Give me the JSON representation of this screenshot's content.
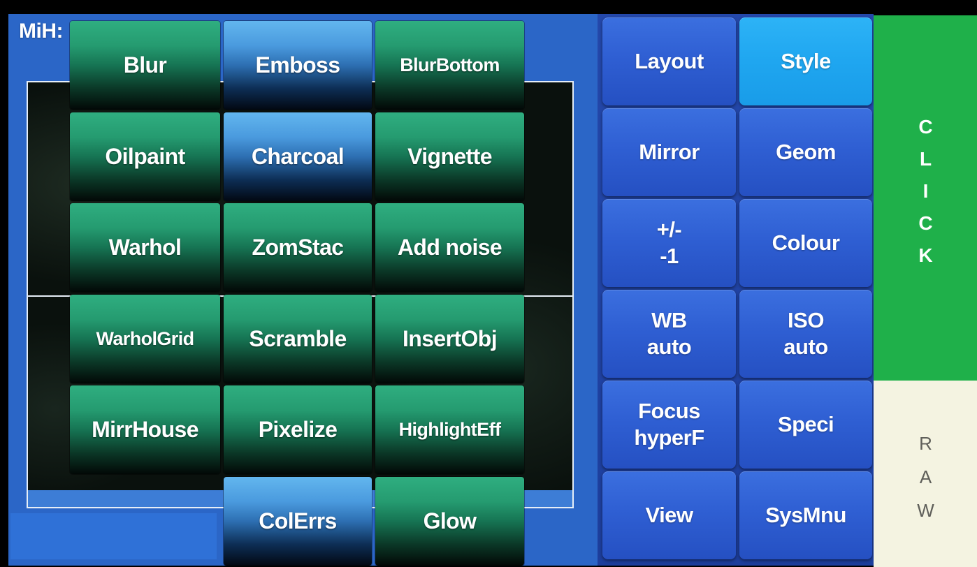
{
  "app": {
    "title": "MiH:"
  },
  "effects": [
    {
      "label": "Blur",
      "tint": "green"
    },
    {
      "label": "Emboss",
      "tint": "blue"
    },
    {
      "label": "BlurBottom",
      "tint": "green"
    },
    {
      "label": "Oilpaint",
      "tint": "green"
    },
    {
      "label": "Charcoal",
      "tint": "blue"
    },
    {
      "label": "Vignette",
      "tint": "green"
    },
    {
      "label": "Warhol",
      "tint": "green"
    },
    {
      "label": "ZomStac",
      "tint": "green"
    },
    {
      "label": "Add noise",
      "tint": "green"
    },
    {
      "label": "WarholGrid",
      "tint": "green"
    },
    {
      "label": "Scramble",
      "tint": "green"
    },
    {
      "label": "InsertObj",
      "tint": "green"
    },
    {
      "label": "MirrHouse",
      "tint": "green"
    },
    {
      "label": "Pixelize",
      "tint": "green"
    },
    {
      "label": "HighlightEff",
      "tint": "green"
    },
    {
      "label": "ColErrs",
      "tint": "blue"
    },
    {
      "label": "Glow",
      "tint": "green"
    }
  ],
  "menu": [
    {
      "label": "Layout",
      "state": "normal"
    },
    {
      "label": "Style",
      "state": "selected"
    },
    {
      "label": "Mirror",
      "state": "normal"
    },
    {
      "label": "Geom",
      "state": "normal"
    },
    {
      "label": "+/-\n-1",
      "state": "normal"
    },
    {
      "label": "Colour",
      "state": "normal"
    },
    {
      "label": "WB\nauto",
      "state": "normal"
    },
    {
      "label": "ISO\nauto",
      "state": "normal"
    },
    {
      "label": "Focus\nhyperF",
      "state": "normal"
    },
    {
      "label": "Speci",
      "state": "normal"
    },
    {
      "label": "View",
      "state": "normal"
    },
    {
      "label": "SysMnu",
      "state": "normal"
    }
  ],
  "side": {
    "click_label": "CLICK",
    "raw_label": "RAW"
  },
  "colors": {
    "app_bg": "#2b66c7",
    "menu_bg": "#1d3e9c",
    "menu_button": "#2f5fd3",
    "menu_selected": "#1fa6f0",
    "effect_green": "#2fae80",
    "effect_blue": "#62b6ee",
    "click_panel": "#1fb04a",
    "raw_panel": "#f4f3e1"
  }
}
